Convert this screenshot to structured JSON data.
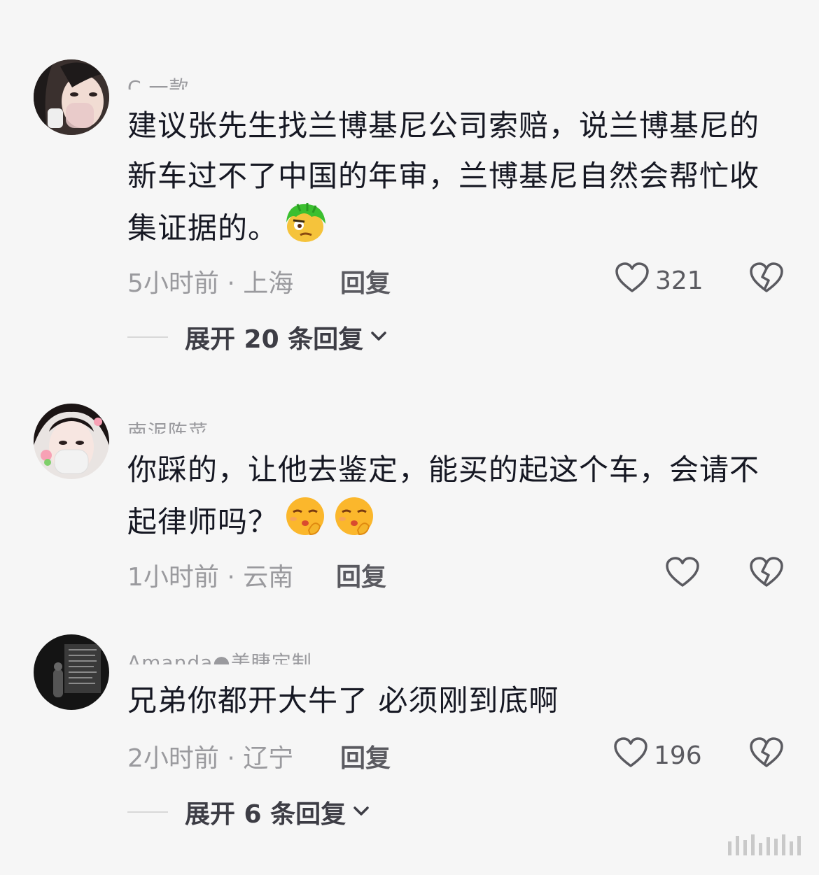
{
  "comments": [
    {
      "username": "C 一款",
      "text": "建议张先生找兰博基尼公司索赔，说兰博基尼的新车过不了中国的年审，兰博基尼自然会帮忙收集证据的。",
      "emoji": "green-hair-face-emoji",
      "time_location": "5小时前 · 上海",
      "reply_label": "回复",
      "likes": "321",
      "expand_label": "展开 20 条回复"
    },
    {
      "username": "南泥陈菜",
      "text": "你踩的，让他去鉴定，能买的起这个车，会请不起律师吗？",
      "emoji": "shushing-face-emoji x2",
      "time_location": "1小时前 · 云南",
      "reply_label": "回复",
      "likes": ""
    },
    {
      "username": "Amanda●美睫定制",
      "text": "兄弟你都开大牛了 必须刚到底啊",
      "time_location": "2小时前 · 辽宁",
      "reply_label": "回复",
      "likes": "196",
      "expand_label": "展开 6 条回复"
    }
  ],
  "colors": {
    "background": "#f6f6f6",
    "primary_text": "#161823",
    "secondary_text": "#9a9a9e",
    "icon": "#5a5a60"
  }
}
